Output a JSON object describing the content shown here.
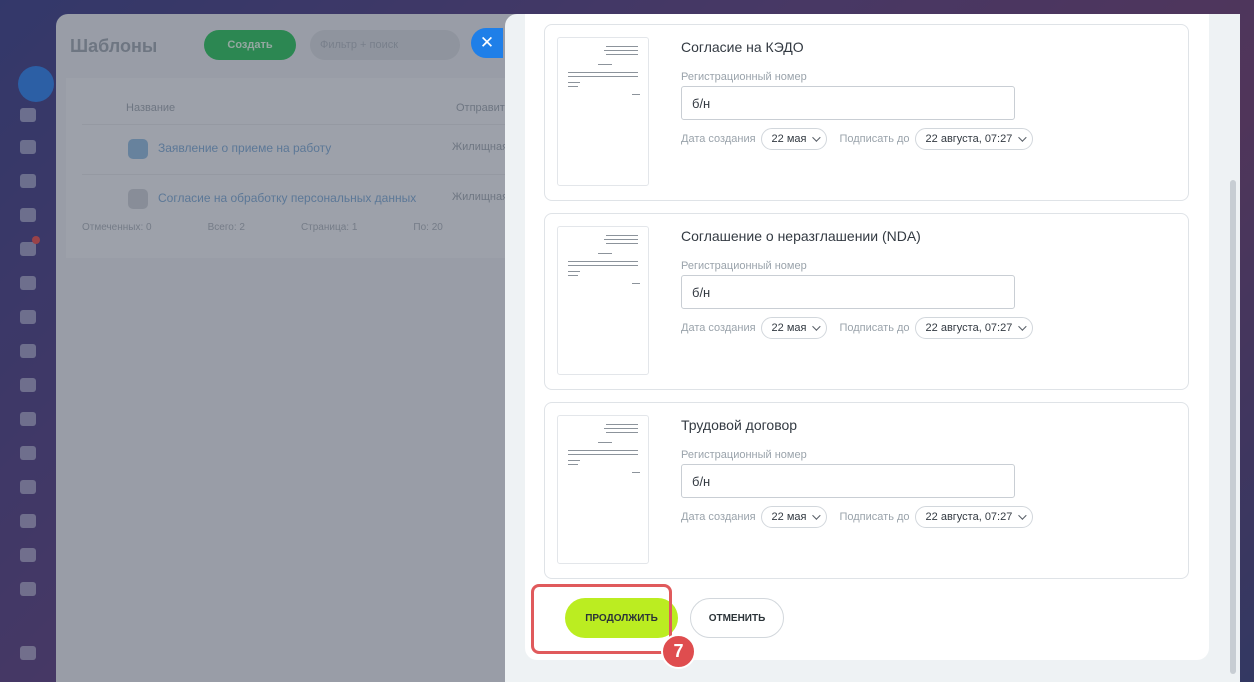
{
  "background_app": {
    "title": "Шаблоны",
    "create_label": "Создать",
    "search_placeholder": "Фильтр + поиск",
    "column_name": "Название",
    "column_sender": "Отправитель",
    "rows": [
      {
        "name": "Заявление о приеме на работу",
        "cell": "Жилищная"
      },
      {
        "name": "Согласие на обработку персональных данных",
        "cell": "Жилищная"
      }
    ],
    "footer": [
      "Отмеченных: 0",
      "Всего: 2",
      "Страница: 1",
      "По: 20"
    ]
  },
  "close_icon": "✕",
  "documents": [
    {
      "name": "Согласие на КЭДО",
      "reg_label": "Регистрационный номер",
      "reg_value": "б/н",
      "created_label": "Дата создания",
      "created_value": "22 мая",
      "sign_label": "Подписать до",
      "sign_value": "22 августа, 07:27"
    },
    {
      "name": "Соглашение о неразглашении (NDA)",
      "reg_label": "Регистрационный номер",
      "reg_value": "б/н",
      "created_label": "Дата создания",
      "created_value": "22 мая",
      "sign_label": "Подписать до",
      "sign_value": "22 августа, 07:27"
    },
    {
      "name": "Трудовой договор",
      "reg_label": "Регистрационный номер",
      "reg_value": "б/н",
      "created_label": "Дата создания",
      "created_value": "22 мая",
      "sign_label": "Подписать до",
      "sign_value": "22 августа, 07:27"
    }
  ],
  "buttons": {
    "continue_label": "ПРОДОЛЖИТЬ",
    "cancel_label": "ОТМЕНИТЬ"
  },
  "annotation": {
    "step_number": "7"
  },
  "colors": {
    "accent_green": "#bbed21",
    "close_blue": "#1f7fe8",
    "annotation_red": "#df4d4f"
  }
}
